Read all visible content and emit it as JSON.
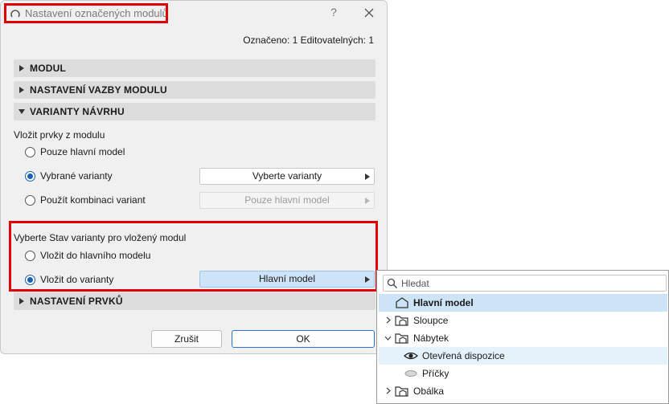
{
  "dialog": {
    "title": "Nastavení označených modulů",
    "counter": "Označeno: 1 Editovatelných: 1",
    "sections": {
      "modul": "MODUL",
      "link": "NASTAVENÍ VAZBY MODULU",
      "variants": "VARIANTY NÁVRHU",
      "elements": "NASTAVENÍ PRVKŮ"
    },
    "insert_from_label": "Vložit prvky z modulu",
    "insert_from_options": [
      {
        "label": "Pouze hlavní model",
        "checked": false
      },
      {
        "label": "Vybrané varianty",
        "checked": true
      },
      {
        "label": "Použít kombinaci variant",
        "checked": false
      }
    ],
    "select_variants_dropdown": "Vyberte varianty",
    "combination_dropdown": "Pouze hlavní model",
    "variant_state_label": "Vyberte Stav varianty pro vložený modul",
    "variant_state_options": [
      {
        "label": "Vložit do hlavního modelu",
        "checked": false
      },
      {
        "label": "Vložit do varianty",
        "checked": true
      }
    ],
    "variant_dropdown": "Hlavní model",
    "cancel_label": "Zrušit",
    "ok_label": "OK",
    "help_glyph": "?"
  },
  "popup": {
    "search_placeholder": "Hledat",
    "items": [
      {
        "label": "Hlavní model",
        "state": "selected"
      },
      {
        "label": "Sloupce",
        "state": "collapsed"
      },
      {
        "label": "Nábytek",
        "state": "expanded"
      },
      {
        "label": "Otevřená dispozice",
        "state": "visible-child"
      },
      {
        "label": "Příčky",
        "state": "hidden-child"
      },
      {
        "label": "Obálka",
        "state": "collapsed"
      }
    ]
  },
  "colors": {
    "highlight": "#e00000",
    "accent": "#1a5fb4",
    "selection": "#cde3f7"
  }
}
